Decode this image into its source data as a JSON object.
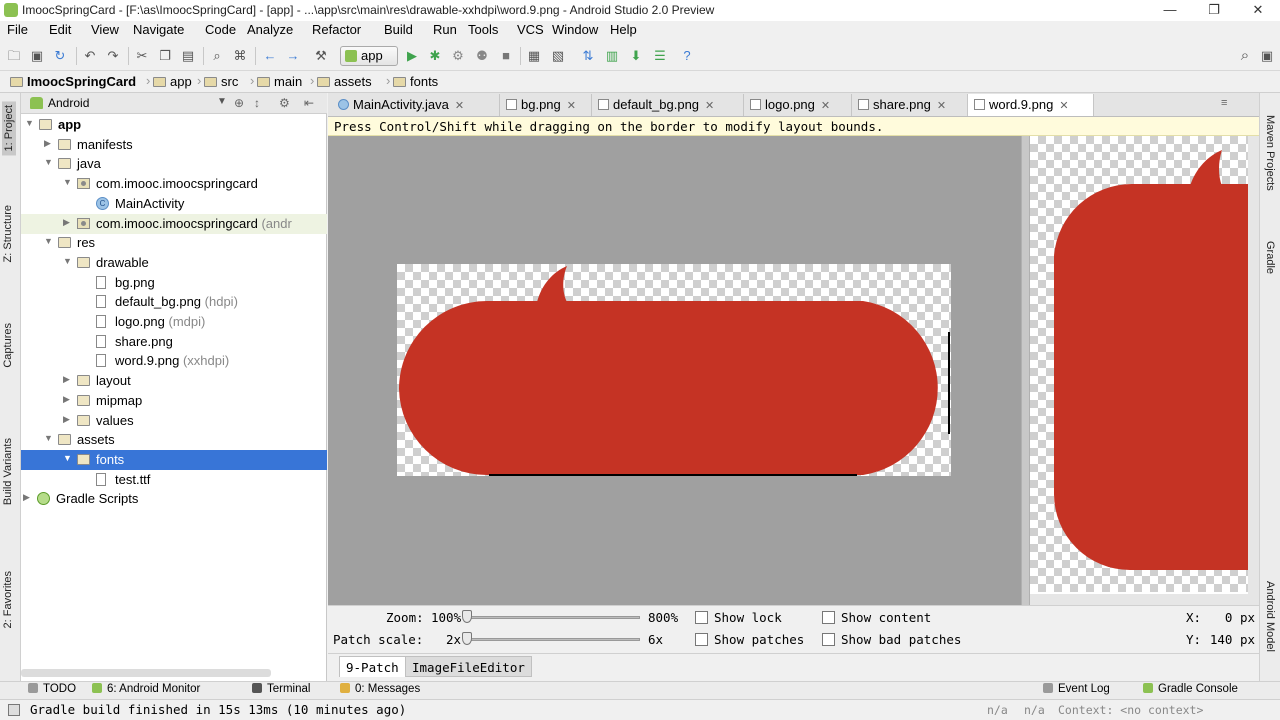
{
  "window": {
    "title": "ImoocSpringCard - [F:\\as\\ImoocSpringCard] - [app] - ...\\app\\src\\main\\res\\drawable-xxhdpi\\word.9.png - Android Studio 2.0 Preview",
    "minimize": "—",
    "maximize": "❐",
    "close": "✕"
  },
  "menu": [
    "File",
    "Edit",
    "View",
    "Navigate",
    "Code",
    "Analyze",
    "Refactor",
    "Build",
    "Run",
    "Tools",
    "VCS",
    "Window",
    "Help"
  ],
  "toolbar": {
    "run_config": "app",
    "help_icon": "?",
    "search_icon": "⚲"
  },
  "breadcrumb": [
    "ImoocSpringCard",
    "app",
    "src",
    "main",
    "assets",
    "fonts"
  ],
  "left_tool_tabs": [
    "1: Project",
    "Z: Structure",
    "Captures",
    "Build Variants",
    "2: Favorites"
  ],
  "right_tool_tabs": [
    "Maven Projects",
    "Gradle",
    "Android Model"
  ],
  "project": {
    "view": "Android",
    "tree": [
      {
        "label": "app",
        "level": 0,
        "expanded": true,
        "type": "module"
      },
      {
        "label": "manifests",
        "level": 1,
        "expanded": false,
        "type": "folder"
      },
      {
        "label": "java",
        "level": 1,
        "expanded": true,
        "type": "folder"
      },
      {
        "label": "com.imooc.imoocspringcard",
        "level": 2,
        "expanded": true,
        "type": "package"
      },
      {
        "label": "MainActivity",
        "level": 3,
        "type": "class"
      },
      {
        "label": "com.imooc.imoocspringcard",
        "suffix": "(andr",
        "level": 2,
        "expanded": false,
        "type": "package"
      },
      {
        "label": "res",
        "level": 1,
        "expanded": true,
        "type": "folder"
      },
      {
        "label": "drawable",
        "level": 2,
        "expanded": true,
        "type": "folder"
      },
      {
        "label": "bg.png",
        "level": 3,
        "type": "file"
      },
      {
        "label": "default_bg.png",
        "suffix": "(hdpi)",
        "level": 3,
        "type": "file"
      },
      {
        "label": "logo.png",
        "suffix": "(mdpi)",
        "level": 3,
        "type": "file"
      },
      {
        "label": "share.png",
        "level": 3,
        "type": "file"
      },
      {
        "label": "word.9.png",
        "suffix": "(xxhdpi)",
        "level": 3,
        "type": "file"
      },
      {
        "label": "layout",
        "level": 2,
        "expanded": false,
        "type": "folder"
      },
      {
        "label": "mipmap",
        "level": 2,
        "expanded": false,
        "type": "folder"
      },
      {
        "label": "values",
        "level": 2,
        "expanded": false,
        "type": "folder"
      },
      {
        "label": "assets",
        "level": 1,
        "expanded": true,
        "type": "folder"
      },
      {
        "label": "fonts",
        "level": 2,
        "expanded": true,
        "type": "folder",
        "selected": true
      },
      {
        "label": "test.ttf",
        "level": 3,
        "type": "file"
      },
      {
        "label": "Gradle Scripts",
        "level": 0,
        "expanded": false,
        "type": "gradle"
      }
    ]
  },
  "editor": {
    "tabs": [
      {
        "label": "MainActivity.java",
        "kind": "class"
      },
      {
        "label": "bg.png",
        "kind": "image"
      },
      {
        "label": "default_bg.png",
        "kind": "image"
      },
      {
        "label": "logo.png",
        "kind": "image"
      },
      {
        "label": "share.png",
        "kind": "image"
      },
      {
        "label": "word.9.png",
        "kind": "image",
        "active": true
      }
    ],
    "hint": "Press Control/Shift while dragging on the border to modify layout bounds.",
    "controls": {
      "zoom_label": "Zoom:",
      "zoom_min": "100%",
      "zoom_max": "800%",
      "zoom_level": 0.0,
      "patch_scale_label": "Patch scale:",
      "patch_min": "2x",
      "patch_max": "6x",
      "patch_level": 0.0,
      "show_lock": "Show lock",
      "show_patches": "Show patches",
      "show_content": "Show content",
      "show_bad_patches": "Show bad patches",
      "x_label": "X:",
      "x_value": "0 px",
      "y_label": "Y:",
      "y_value": "140 px"
    },
    "mode_tabs": [
      {
        "label": "9-Patch",
        "active": true
      },
      {
        "label": "ImageFileEditor",
        "active": false
      }
    ],
    "bubble_color": "#c53324"
  },
  "bottom_tabs": [
    {
      "label": "TODO"
    },
    {
      "label": "6: Android Monitor"
    },
    {
      "label": "Terminal"
    },
    {
      "label": "0: Messages"
    },
    {
      "label": "Event Log"
    },
    {
      "label": "Gradle Console"
    }
  ],
  "status": {
    "message": "Gradle build finished in 15s 13ms (10 minutes ago)",
    "na1": "n/a",
    "na2": "n/a",
    "context": "Context: <no context>"
  }
}
